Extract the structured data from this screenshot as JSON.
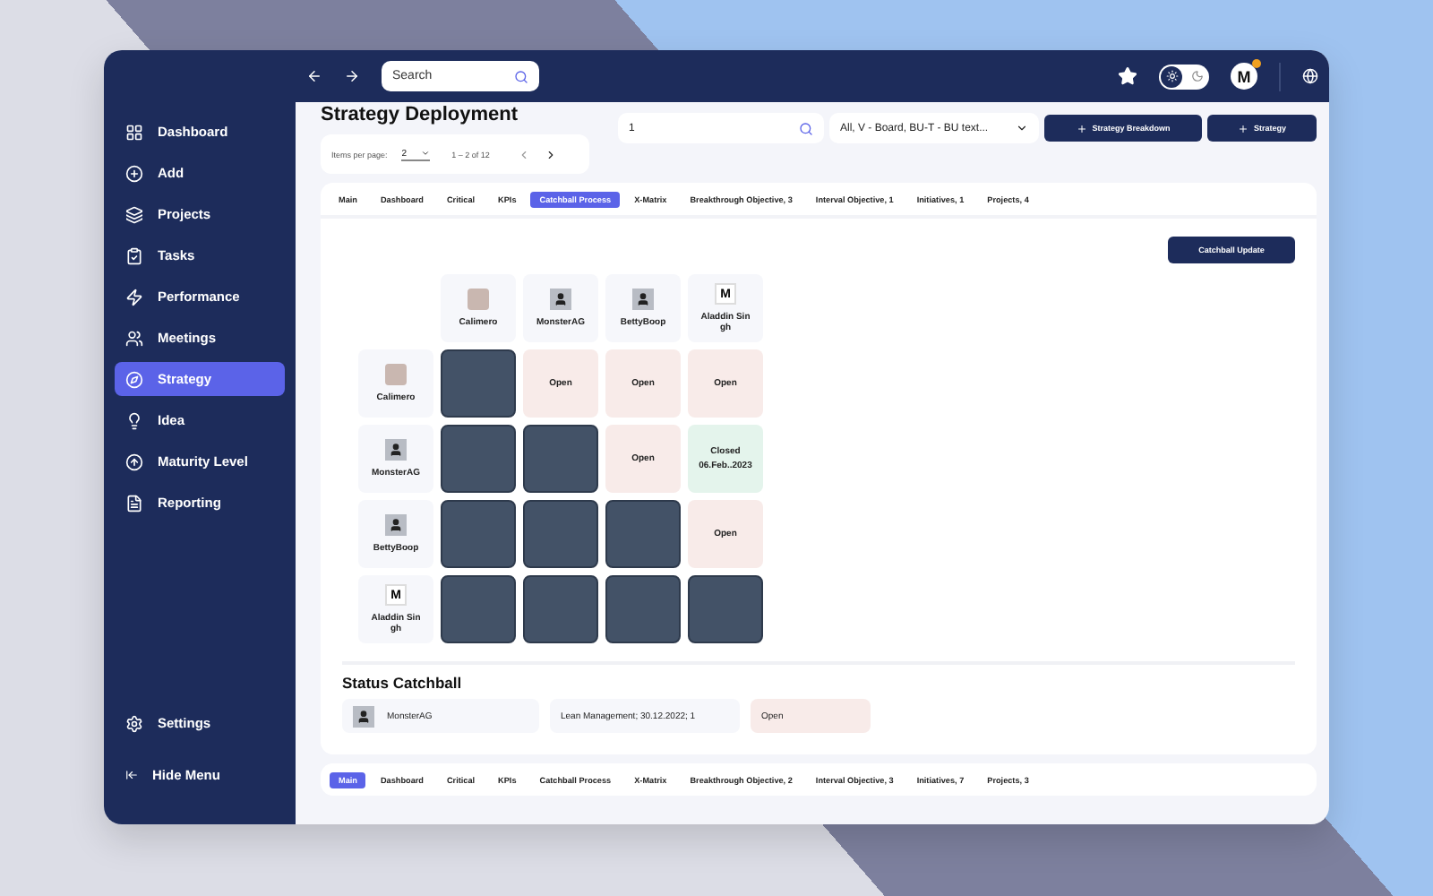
{
  "sidebar": {
    "items": [
      {
        "label": "Dashboard",
        "selected": false
      },
      {
        "label": "Add",
        "selected": false
      },
      {
        "label": "Projects",
        "selected": false
      },
      {
        "label": "Tasks",
        "selected": false
      },
      {
        "label": "Performance",
        "selected": false
      },
      {
        "label": "Meetings",
        "selected": false
      },
      {
        "label": "Strategy",
        "selected": true
      },
      {
        "label": "Idea",
        "selected": false
      },
      {
        "label": "Maturity Level",
        "selected": false
      },
      {
        "label": "Reporting",
        "selected": false
      }
    ],
    "footer": [
      {
        "label": "Settings"
      },
      {
        "label": "Hide Menu"
      }
    ]
  },
  "topbar": {
    "search": {
      "placeholder": "Search"
    },
    "theme_toggle": {
      "dark": false
    },
    "user": {
      "initial": "M"
    }
  },
  "header": {
    "title": "Strategy Deployment",
    "paginator": {
      "label": "Items per page:",
      "value": "2",
      "range": "1 – 2 of 12"
    },
    "filter_search": {
      "value": "1"
    },
    "dropdown": {
      "value": "All, V - Board, BU-T - BU text..."
    },
    "buttons": [
      "Strategy Breakdown",
      "Strategy"
    ]
  },
  "tabs": [
    {
      "label": "Main",
      "selected": false
    },
    {
      "label": "Dashboard",
      "selected": false
    },
    {
      "label": "Critical",
      "selected": false
    },
    {
      "label": "KPIs",
      "selected": false
    },
    {
      "label": "Catchball Process",
      "selected": true
    },
    {
      "label": "X-Matrix",
      "selected": false
    },
    {
      "label": "Breakthrough Objective, 3",
      "selected": false
    },
    {
      "label": "Interval Objective, 1",
      "selected": false
    },
    {
      "label": "Initiatives, 1",
      "selected": false
    },
    {
      "label": "Projects, 4",
      "selected": false
    }
  ],
  "catchball_button": "Catchball Update",
  "matrix": {
    "columns": [
      {
        "name": "Calimero",
        "kind": "photo"
      },
      {
        "name": "MonsterAG",
        "kind": "person"
      },
      {
        "name": "BettyBoop",
        "kind": "person"
      },
      {
        "name": "Aladdin Sin gh",
        "kind": "logo",
        "initial": "M"
      }
    ],
    "rows": [
      {
        "name": "Calimero",
        "kind": "photo",
        "cells": [
          {
            "kind": "blocked"
          },
          {
            "kind": "open",
            "text": "Open"
          },
          {
            "kind": "open",
            "text": "Open"
          },
          {
            "kind": "open",
            "text": "Open"
          }
        ]
      },
      {
        "name": "MonsterAG",
        "kind": "person",
        "cells": [
          {
            "kind": "blocked"
          },
          {
            "kind": "blocked"
          },
          {
            "kind": "open",
            "text": "Open"
          },
          {
            "kind": "closed",
            "text": "Closed",
            "date": "06.Feb..2023"
          }
        ]
      },
      {
        "name": "BettyBoop",
        "kind": "person",
        "cells": [
          {
            "kind": "blocked"
          },
          {
            "kind": "blocked"
          },
          {
            "kind": "blocked"
          },
          {
            "kind": "open",
            "text": "Open"
          }
        ]
      },
      {
        "name": "Aladdin Sin gh",
        "kind": "logo",
        "initial": "M",
        "cells": [
          {
            "kind": "blocked"
          },
          {
            "kind": "blocked"
          },
          {
            "kind": "blocked"
          },
          {
            "kind": "blocked"
          }
        ]
      }
    ]
  },
  "status": {
    "title": "Status Catchball",
    "person": "MonsterAG",
    "detail": "Lean Management; 30.12.2022; 1",
    "state": "Open"
  },
  "tabs_2": [
    {
      "label": "Main",
      "selected": true
    },
    {
      "label": "Dashboard",
      "selected": false
    },
    {
      "label": "Critical",
      "selected": false
    },
    {
      "label": "KPIs",
      "selected": false
    },
    {
      "label": "Catchball Process",
      "selected": false
    },
    {
      "label": "X-Matrix",
      "selected": false
    },
    {
      "label": "Breakthrough Objective, 2",
      "selected": false
    },
    {
      "label": "Interval Objective, 3",
      "selected": false
    },
    {
      "label": "Initiatives, 7",
      "selected": false
    },
    {
      "label": "Projects, 3",
      "selected": false
    }
  ]
}
